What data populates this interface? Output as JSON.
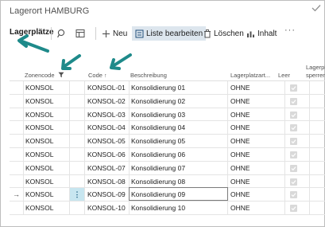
{
  "window": {
    "title": "Lagerort HAMBURG"
  },
  "toolbar": {
    "page_label": "Lagerplätze",
    "new_label": "Neu",
    "edit_list_label": "Liste bearbeiten",
    "delete_label": "Löschen",
    "content_label": "Inhalt",
    "more_label": "···"
  },
  "table": {
    "headers": {
      "zone": "Zonencode",
      "code": "Code",
      "code_sort": "↑",
      "description": "Beschreibung",
      "bin_type": "Lagerplatzart...",
      "empty": "Leer",
      "blocked_line1": "Lagerpl",
      "blocked_line2": "sperren"
    },
    "rows": [
      {
        "zone": "KONSOL",
        "code": "KONSOL-01",
        "description": "Konsolidierung 01",
        "bin_type": "OHNE",
        "empty": true
      },
      {
        "zone": "KONSOL",
        "code": "KONSOL-02",
        "description": "Konsolidierung 02",
        "bin_type": "OHNE",
        "empty": true
      },
      {
        "zone": "KONSOL",
        "code": "KONSOL-03",
        "description": "Konsolidierung 03",
        "bin_type": "OHNE",
        "empty": true
      },
      {
        "zone": "KONSOL",
        "code": "KONSOL-04",
        "description": "Konsolidierung 04",
        "bin_type": "OHNE",
        "empty": true
      },
      {
        "zone": "KONSOL",
        "code": "KONSOL-05",
        "description": "Konsolidierung 05",
        "bin_type": "OHNE",
        "empty": true
      },
      {
        "zone": "KONSOL",
        "code": "KONSOL-06",
        "description": "Konsolidierung 06",
        "bin_type": "OHNE",
        "empty": true
      },
      {
        "zone": "KONSOL",
        "code": "KONSOL-07",
        "description": "Konsolidierung 07",
        "bin_type": "OHNE",
        "empty": true
      },
      {
        "zone": "KONSOL",
        "code": "KONSOL-08",
        "description": "Konsolidierung 08",
        "bin_type": "OHNE",
        "empty": true
      },
      {
        "zone": "KONSOL",
        "code": "KONSOL-09",
        "description": "Konsolidierung 09",
        "bin_type": "OHNE",
        "empty": true
      },
      {
        "zone": "KONSOL",
        "code": "KONSOL-10",
        "description": "Konsolidierung 10",
        "bin_type": "OHNE",
        "empty": true
      }
    ],
    "selected_row_index": 8,
    "row_marker": "→",
    "row_actions_glyph": "⋮"
  },
  "colors": {
    "annotation_arrow": "#1e8a8a",
    "selected_action_bg": "#dde6ee",
    "row_action_bg": "#c7e6f0"
  },
  "icons": {
    "search": "search-icon",
    "layout": "layout-icon",
    "new": "plus-icon",
    "edit_list": "edit-list-icon",
    "delete": "trash-icon",
    "content": "chart-icon",
    "filter": "filter-icon",
    "top_right": "check-icon"
  }
}
